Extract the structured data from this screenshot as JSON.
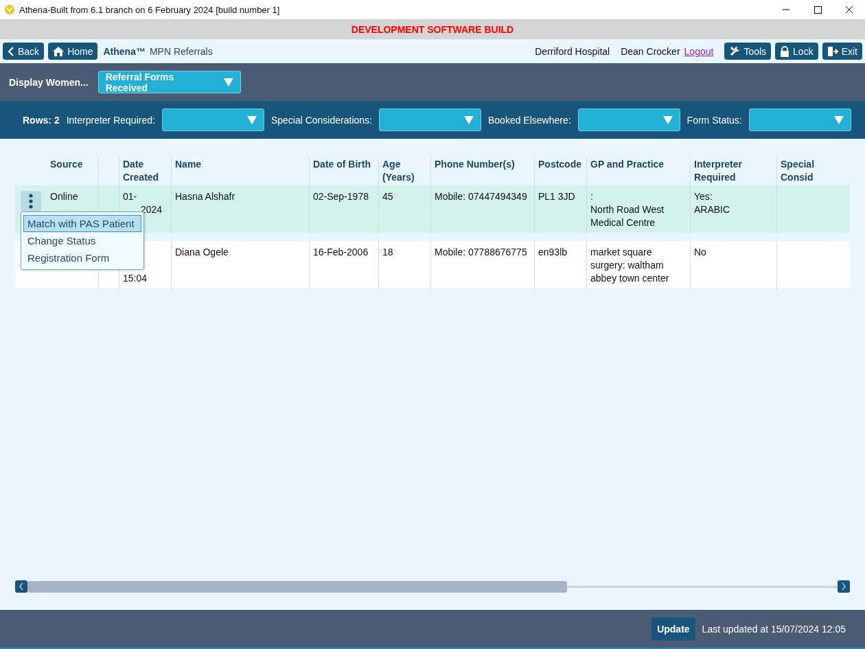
{
  "window": {
    "title": "Athena-Built from 6.1 branch on 6 February 2024 [build number 1]"
  },
  "banner": "DEVELOPMENT SOFTWARE BUILD",
  "nav": {
    "back": "Back",
    "home": "Home",
    "app_name": "Athena™",
    "module": "MPN Referrals",
    "site": "Derriford Hospital",
    "user": "Dean Crocker",
    "logout": "Logout",
    "buttons": [
      {
        "kind": "tools",
        "label": "Tools"
      },
      {
        "kind": "lock",
        "label": "Lock"
      },
      {
        "kind": "exit",
        "label": "Exit"
      }
    ]
  },
  "display": {
    "label": "Display Women...",
    "value": "Referral Forms Received"
  },
  "filters": {
    "rows": "Rows: 2",
    "fields": [
      {
        "label": "Interpreter Required:"
      },
      {
        "label": "Special Considerations:"
      },
      {
        "label": "Booked Elsewhere:"
      },
      {
        "label": "Form Status:"
      }
    ]
  },
  "table": {
    "columns": [
      "Source",
      "Date Created",
      "Name",
      "Date of Birth",
      "Age (Years)",
      "Phone Number(s)",
      "Postcode",
      "GP and Practice",
      "Interpreter Required",
      "Special Consid"
    ],
    "rows": [
      {
        "selected": true,
        "cells": [
          "Online",
          {
            "lines": [
              {
                "kind": "line",
                "text": "01-"
              },
              {
                "kind": "tail",
                "text": "2024"
              }
            ]
          },
          "Hasna Alshafr",
          "02-Sep-1978",
          "45",
          "Mobile: 07447494349",
          "PL1 3JD",
          ":\nNorth Road West Medical Centre",
          "Yes:\nARABIC",
          ""
        ]
      },
      {
        "selected": false,
        "cells": [
          "",
          {
            "lines": [
              {
                "kind": "bottom",
                "text": "15:04"
              }
            ]
          },
          "Diana Ogele",
          "16-Feb-2006",
          "18",
          "Mobile: 07788676775",
          "en93lb",
          "market square surgery: waltham abbey town center",
          "No",
          ""
        ]
      }
    ]
  },
  "row_menu": {
    "items": [
      {
        "label": "Match with PAS Patient",
        "selected": true
      },
      {
        "label": "Change Status",
        "selected": false
      },
      {
        "label": "Registration Form",
        "selected": false
      }
    ]
  },
  "footer": {
    "update": "Update",
    "last_updated": "Last updated at 15/07/2024 12:05"
  }
}
